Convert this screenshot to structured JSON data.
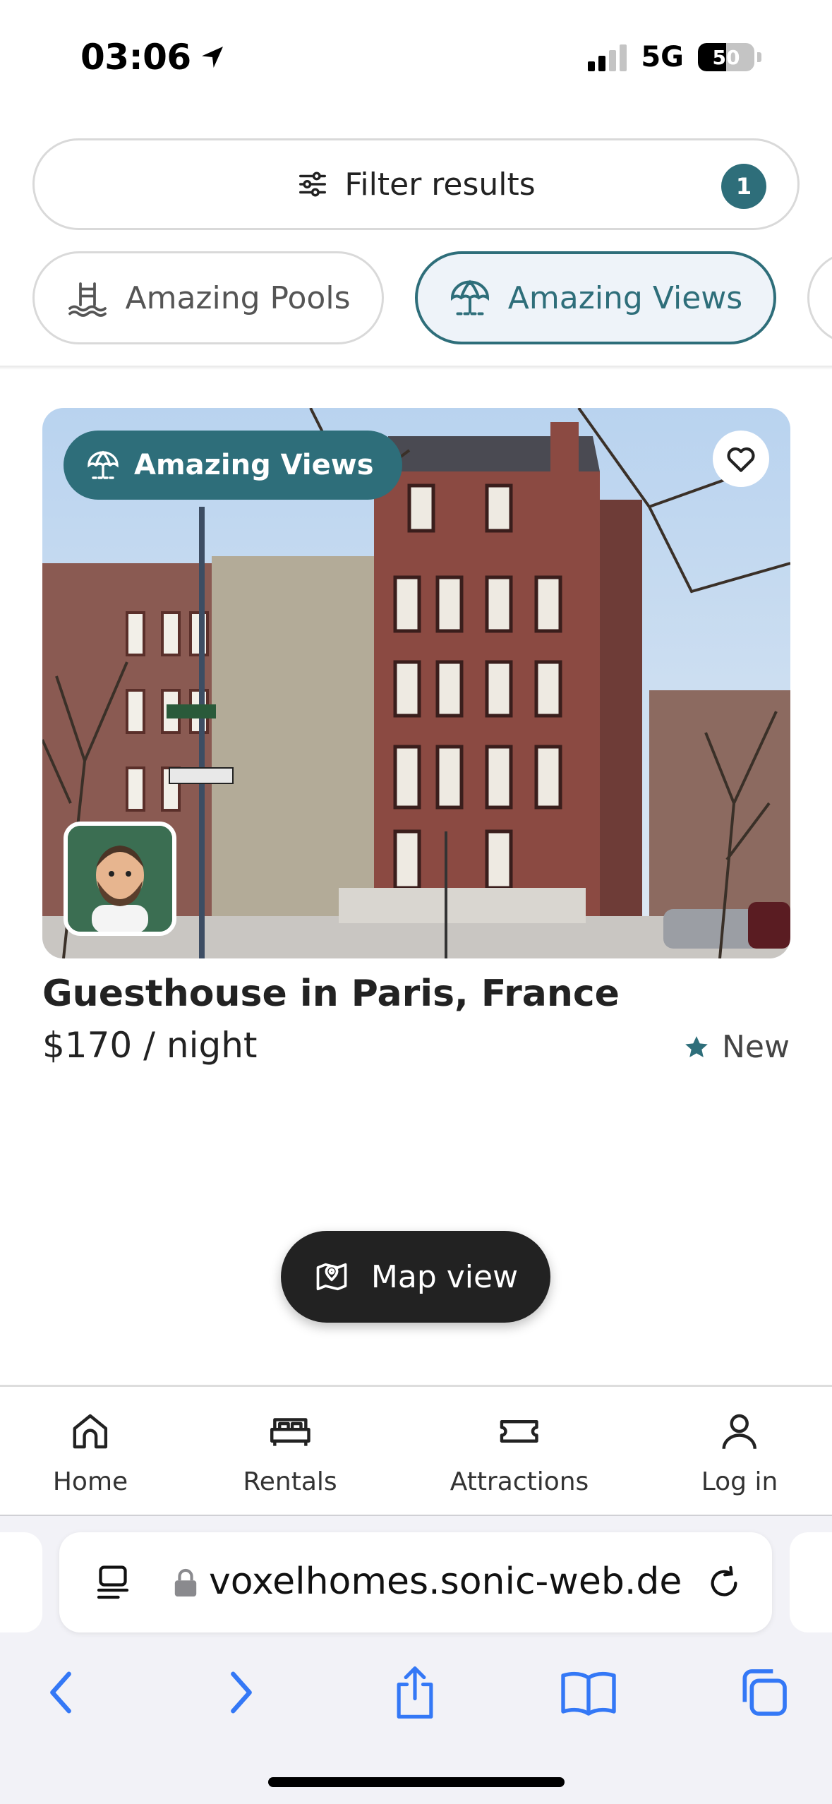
{
  "status_bar": {
    "time": "03:06",
    "network": "5G",
    "battery": "50",
    "battery_level": 0.5
  },
  "filter": {
    "label": "Filter results",
    "count": "1"
  },
  "chips": [
    {
      "label": "Amazing Pools",
      "icon": "pool-icon",
      "active": false
    },
    {
      "label": "Amazing Views",
      "icon": "beach-umbrella-icon",
      "active": true
    }
  ],
  "listing": {
    "badge": "Amazing Views",
    "title": "Guesthouse in Paris, France",
    "price": "$170 / night",
    "rating": "New"
  },
  "map_button": {
    "label": "Map view"
  },
  "bottom_nav": {
    "items": [
      {
        "label": "Home",
        "icon": "home-icon"
      },
      {
        "label": "Rentals",
        "icon": "bed-icon"
      },
      {
        "label": "Attractions",
        "icon": "ticket-icon"
      },
      {
        "label": "Log in",
        "icon": "user-icon"
      }
    ]
  },
  "browser": {
    "url": "voxelhomes.sonic-web.de"
  },
  "colors": {
    "accent": "#2e6e7a",
    "chip_active_bg": "#eef3f9",
    "dark_button": "#222222",
    "safari_blue": "#3478f6"
  }
}
